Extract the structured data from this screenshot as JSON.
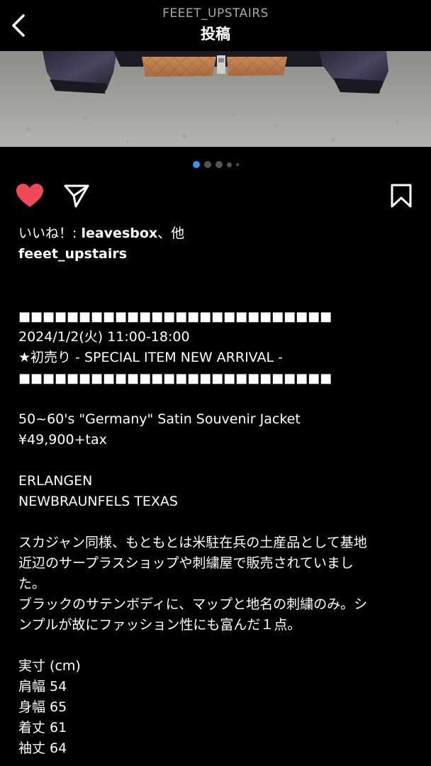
{
  "header": {
    "username": "FEEET_UPSTAIRS",
    "title": "投稿"
  },
  "carousel": {
    "total": 5,
    "active_index": 0
  },
  "likes": {
    "prefix": "いいね！: ",
    "user": "leavesbox",
    "suffix": "、他"
  },
  "post": {
    "author": "feeet_upstairs",
    "caption_lines": [
      "■■■■■■■■■■■■■■■■■■■■■■■■■■",
      "2024/1/2(火) 11:00-18:00",
      "★初売り - SPECIAL ITEM NEW ARRIVAL -",
      "■■■■■■■■■■■■■■■■■■■■■■■■■■",
      "",
      "50~60's \"Germany\" Satin Souvenir Jacket",
      "¥49,900+tax",
      "",
      "ERLANGEN",
      "NEWBRAUNFELS TEXAS",
      "",
      "スカジャン同様、もともとは米駐在兵の土産品として基地",
      "近辺のサープラスショップや刺繍屋で販売されていまし",
      "た。",
      "ブラックのサテンボディに、マップと地名の刺繍のみ。シ",
      "ンプルが故にファッション性にも富んだ１点。",
      "",
      "実寸 (cm)",
      "肩幅 54",
      "身幅 65",
      "着丈 61",
      "袖丈 64"
    ]
  },
  "colors": {
    "like": "#ed4956",
    "active_dot": "#3897f0",
    "background": "#000000"
  }
}
